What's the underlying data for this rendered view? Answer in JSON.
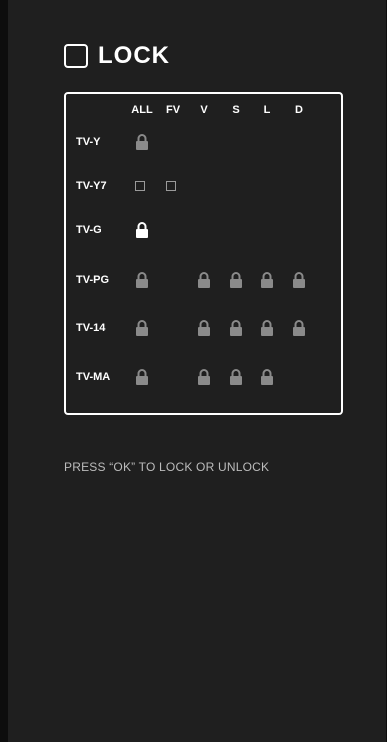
{
  "title": "LOCK",
  "columns": [
    "ALL",
    "FV",
    "V",
    "S",
    "L",
    "D"
  ],
  "rows": [
    {
      "label": "TV-Y",
      "cells": [
        "locked",
        "",
        "",
        "",
        "",
        ""
      ]
    },
    {
      "label": "TV-Y7",
      "cells": [
        "unlocked",
        "unlocked",
        "",
        "",
        "",
        ""
      ]
    },
    {
      "label": "TV-G",
      "cells": [
        "locked-active",
        "",
        "",
        "",
        "",
        ""
      ]
    },
    {
      "label": "TV-PG",
      "cells": [
        "locked",
        "",
        "locked",
        "locked",
        "locked",
        "locked"
      ]
    },
    {
      "label": "TV-14",
      "cells": [
        "locked",
        "",
        "locked",
        "locked",
        "locked",
        "locked"
      ]
    },
    {
      "label": "TV-MA",
      "cells": [
        "locked",
        "",
        "locked",
        "locked",
        "locked",
        ""
      ]
    }
  ],
  "hint": "PRESS “OK” TO LOCK OR UNLOCK",
  "colors": {
    "background": "#1f1f1f",
    "text": "#ffffff",
    "lock_inactive": "#8a8a8a",
    "lock_active": "#ffffff"
  }
}
